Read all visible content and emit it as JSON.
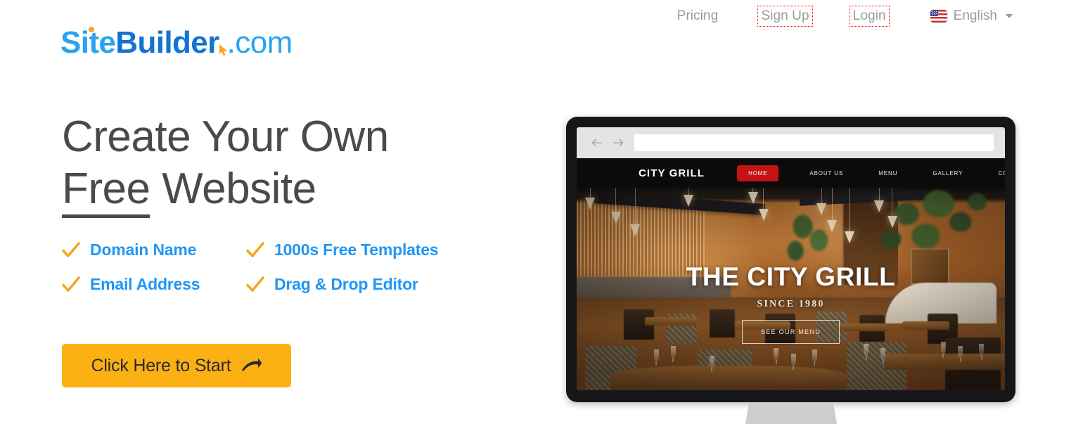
{
  "topnav": {
    "pricing": "Pricing",
    "signup": "Sign Up",
    "login": "Login",
    "language": "English",
    "flag_icon": "us-flag-icon",
    "caret_icon": "chevron-down-icon"
  },
  "logo": {
    "part1": "Site",
    "part2": "Builder",
    "part3": ".com",
    "cursor_icon": "cursor-arrow-icon",
    "color_light": "#2aa3f0",
    "color_dark": "#1174d1",
    "dot_color": "#f5a623"
  },
  "hero": {
    "headline_line1": "Create Your Own",
    "headline_free": "Free",
    "headline_rest": " Website",
    "headline_color": "#4a4a4a"
  },
  "features": {
    "check_icon": "checkmark-icon",
    "check_color": "#f5a623",
    "label_color": "#2196f3",
    "items": [
      {
        "label": "Domain Name"
      },
      {
        "label": "1000s Free Templates"
      },
      {
        "label": "Email Address"
      },
      {
        "label": "Drag & Drop Editor"
      }
    ]
  },
  "cta": {
    "label": "Click Here to Start",
    "arrow_icon": "arrow-right-icon",
    "bg_color": "#fbb114"
  },
  "preview": {
    "browser": {
      "back_icon": "arrow-left-icon",
      "forward_icon": "arrow-right-icon",
      "url_value": "",
      "url_placeholder": ""
    },
    "site": {
      "brand": "CITY GRILL",
      "nav": [
        {
          "label": "HOME",
          "active": true
        },
        {
          "label": "ABOUT US",
          "active": false
        },
        {
          "label": "MENU",
          "active": false
        },
        {
          "label": "GALLERY",
          "active": false
        },
        {
          "label": "CONTACT US",
          "active": false
        }
      ],
      "active_color": "#c51212",
      "hero_title": "THE CITY GRILL",
      "hero_subtitle": "SINCE 1980",
      "hero_button": "SEE OUR MENU"
    }
  }
}
